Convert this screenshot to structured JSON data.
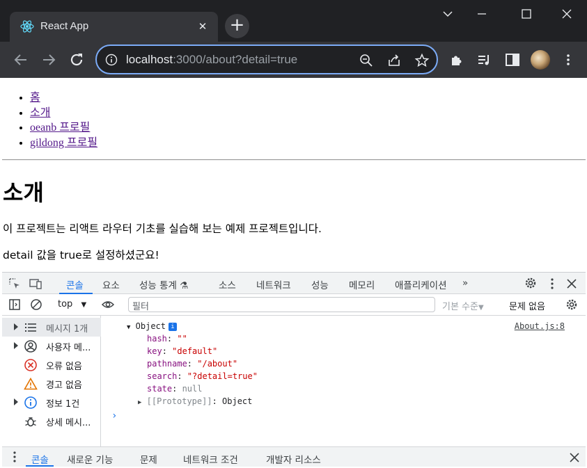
{
  "browser": {
    "tab_title": "React App",
    "url_host": "localhost",
    "url_rest": ":3000/about?detail=true"
  },
  "page": {
    "nav": [
      {
        "label": "홈"
      },
      {
        "label": "소개"
      },
      {
        "label": "oeanb 프로필"
      },
      {
        "label": "gildong 프로필"
      }
    ],
    "heading": "소개",
    "intro": "이 프로젝트는 리액트 라우터 기초를 실습해 보는 예제 프로젝트입니다.",
    "detail_msg": "detail 값을 true로 설정하셨군요!"
  },
  "devtools": {
    "tabs": [
      "콘솔",
      "요소",
      "성능 통계",
      "소스",
      "네트워크",
      "성능",
      "메모리",
      "애플리케이션"
    ],
    "context": "top",
    "filter_placeholder": "필터",
    "levels": "기본 수준",
    "issues": "문제 없음",
    "sidebar": [
      {
        "label": "메시지 1개",
        "icon": "list-icon"
      },
      {
        "label": "사용자 메...",
        "icon": "user-icon"
      },
      {
        "label": "오류 없음",
        "icon": "error-icon"
      },
      {
        "label": "경고 없음",
        "icon": "warning-icon"
      },
      {
        "label": "정보 1건",
        "icon": "info-icon"
      },
      {
        "label": "상세 메시...",
        "icon": "bug-icon"
      }
    ],
    "log": {
      "object_label": "Object",
      "source": "About.js:8",
      "fields": [
        {
          "key": "hash",
          "value": "\"\""
        },
        {
          "key": "key",
          "value": "\"default\""
        },
        {
          "key": "pathname",
          "value": "\"/about\""
        },
        {
          "key": "search",
          "value": "\"?detail=true\""
        },
        {
          "key": "state",
          "value": "null"
        }
      ],
      "prototype_key": "[[Prototype]]",
      "prototype_value": "Object"
    },
    "drawer_tabs": [
      "콘솔",
      "새로운 기능",
      "문제",
      "네트워크 조건",
      "개발자 리소스"
    ]
  }
}
